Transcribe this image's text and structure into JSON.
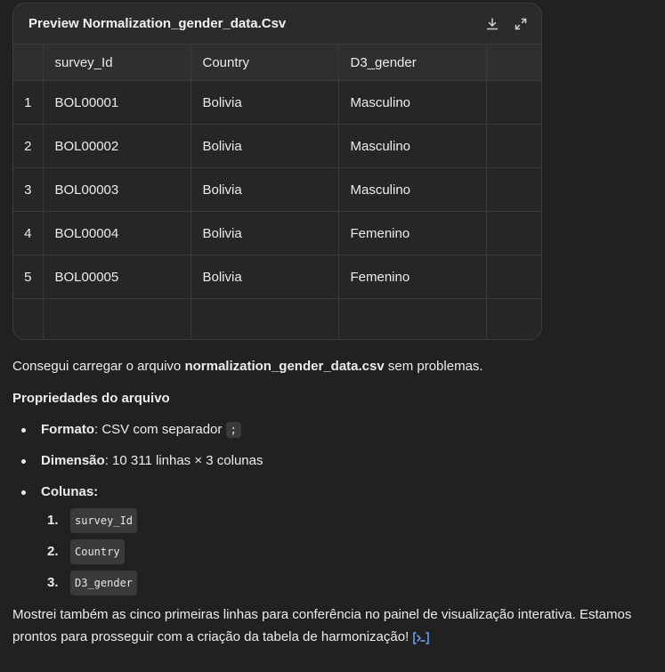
{
  "preview": {
    "title": "Preview Normalization_gender_data.Csv",
    "columns": [
      "survey_Id",
      "Country",
      "D3_gender"
    ],
    "rows": [
      {
        "n": "1",
        "survey_id": "BOL00001",
        "country": "Bolivia",
        "gender": "Masculino"
      },
      {
        "n": "2",
        "survey_id": "BOL00002",
        "country": "Bolivia",
        "gender": "Masculino"
      },
      {
        "n": "3",
        "survey_id": "BOL00003",
        "country": "Bolivia",
        "gender": "Masculino"
      },
      {
        "n": "4",
        "survey_id": "BOL00004",
        "country": "Bolivia",
        "gender": "Femenino"
      },
      {
        "n": "5",
        "survey_id": "BOL00005",
        "country": "Bolivia",
        "gender": "Femenino"
      }
    ]
  },
  "message": {
    "intro_before": "Consegui carregar o arquivo ",
    "intro_file": "normalization_gender_data.csv",
    "intro_after": " sem problemas.",
    "props_heading": "Propriedades do arquivo",
    "format_label": "Formato",
    "format_text": ": CSV com separador ",
    "format_sep": ";",
    "dim_label": "Dimensão",
    "dim_text": ": 10 311 linhas × 3 colunas",
    "cols_label": "Colunas:",
    "col_list": [
      {
        "num": "1.",
        "name": "survey_Id"
      },
      {
        "num": "2.",
        "name": "Country"
      },
      {
        "num": "3.",
        "name": "D3_gender"
      }
    ],
    "final": "Mostrei também as cinco primeiras linhas para conferência no painel de visualização interativa. Estamos prontos para prosseguir com a criação da tabela de harmonização!"
  },
  "icons": {
    "download": "download-icon",
    "expand": "expand-icon",
    "trace": "code-trace-icon"
  },
  "colors": {
    "background": "#212121",
    "card": "#2b2b2b",
    "accent": "#6ea8fe"
  }
}
